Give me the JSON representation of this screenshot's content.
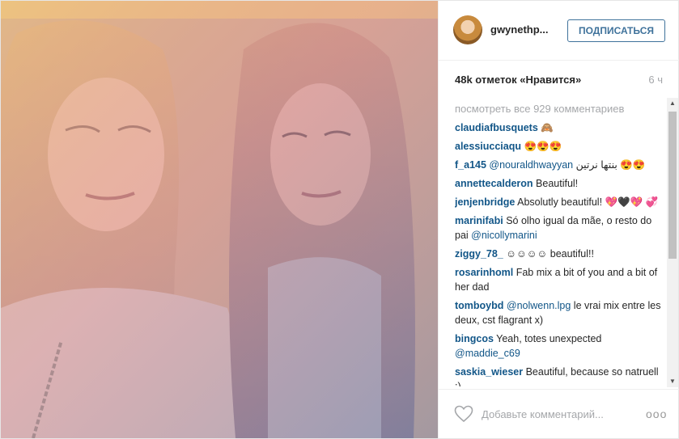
{
  "header": {
    "username": "gwynethp...",
    "follow_label": "ПОДПИСАТЬСЯ"
  },
  "stats": {
    "likes": "48k отметок «Нравится»",
    "time": "6 ч"
  },
  "comments": {
    "view_all": "посмотреть все 929 комментариев",
    "items": [
      {
        "user": "claudiafbusquets",
        "mention": "",
        "text": " 🙈"
      },
      {
        "user": "alessiucciaqu",
        "mention": "",
        "text": " 😍😍😍"
      },
      {
        "user": "f_a145",
        "mention": " @nouraldhwayyan",
        "text": " بنتها نرتين 😍😍"
      },
      {
        "user": "annettecalderon",
        "mention": "",
        "text": " Beautiful!"
      },
      {
        "user": "jenjenbridge",
        "mention": "",
        "text": " Absolutly beautiful! 💖🖤💖 💞"
      },
      {
        "user": "marinifabi",
        "mention": "",
        "text": " Só olho igual da mãe, o resto do pai ",
        "mention_after": "@nicollymarini"
      },
      {
        "user": "ziggy_78_",
        "mention": "",
        "text": " ☺☺☺☺ beautiful!!"
      },
      {
        "user": "rosarinhoml",
        "mention": "",
        "text": " Fab mix a bit of you and a bit of her dad"
      },
      {
        "user": "tomboybd",
        "mention": " @nolwenn.lpg",
        "text": " le vrai mix entre les deux, cst flagrant x)"
      },
      {
        "user": "bingcos",
        "mention": "",
        "text": " Yeah, totes unexpected ",
        "mention_after": "@maddie_c69"
      },
      {
        "user": "saskia_wieser",
        "mention": "",
        "text": " Beautiful, because so natruell :)"
      }
    ]
  },
  "footer": {
    "comment_placeholder": "Добавьте комментарий...",
    "more_label": "ooo"
  },
  "icons": {
    "like": "heart-icon",
    "more": "more-options-icon"
  }
}
